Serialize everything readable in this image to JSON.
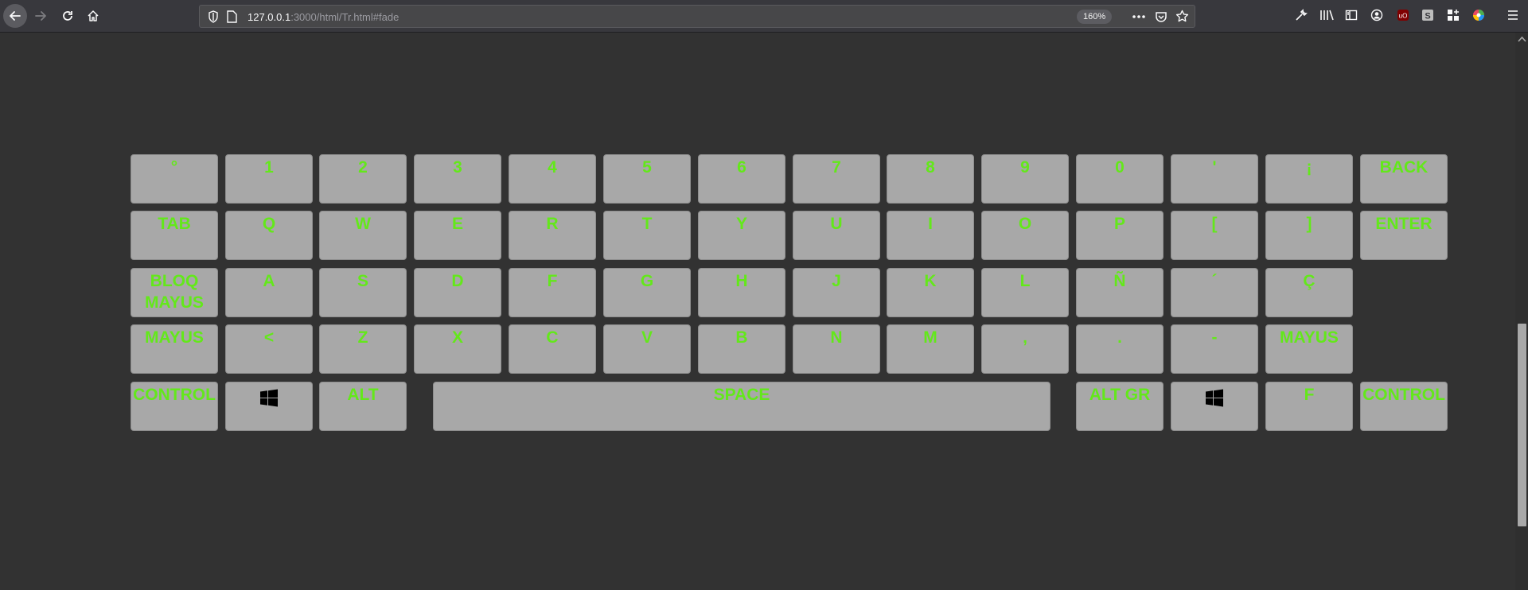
{
  "browser": {
    "url_host": "127.0.0.1",
    "url_rest": ":3000/html/Tr.html#fade",
    "zoom": "160%"
  },
  "keyboard": {
    "rows": [
      [
        {
          "label": "°"
        },
        {
          "label": "1"
        },
        {
          "label": "2"
        },
        {
          "label": "3"
        },
        {
          "label": "4"
        },
        {
          "label": "5"
        },
        {
          "label": "6"
        },
        {
          "label": "7"
        },
        {
          "label": "8"
        },
        {
          "label": "9"
        },
        {
          "label": "0"
        },
        {
          "label": "'"
        },
        {
          "label": "¡"
        },
        {
          "label": "BACK"
        }
      ],
      [
        {
          "label": "TAB"
        },
        {
          "label": "Q"
        },
        {
          "label": "W"
        },
        {
          "label": "E"
        },
        {
          "label": "R"
        },
        {
          "label": "T"
        },
        {
          "label": "Y"
        },
        {
          "label": "U"
        },
        {
          "label": "I"
        },
        {
          "label": "O"
        },
        {
          "label": "P"
        },
        {
          "label": "["
        },
        {
          "label": "]"
        },
        {
          "label": "ENTER"
        }
      ],
      [
        {
          "label": "BLOQ MAYUS"
        },
        {
          "label": "A"
        },
        {
          "label": "S"
        },
        {
          "label": "D"
        },
        {
          "label": "F"
        },
        {
          "label": "G"
        },
        {
          "label": "H"
        },
        {
          "label": "J"
        },
        {
          "label": "K"
        },
        {
          "label": "L"
        },
        {
          "label": "Ñ"
        },
        {
          "label": "´"
        },
        {
          "label": "Ç"
        }
      ],
      [
        {
          "label": "MAYUS"
        },
        {
          "label": "<"
        },
        {
          "label": "Z"
        },
        {
          "label": "X"
        },
        {
          "label": "C"
        },
        {
          "label": "V"
        },
        {
          "label": "B"
        },
        {
          "label": "N"
        },
        {
          "label": "M"
        },
        {
          "label": ","
        },
        {
          "label": "."
        },
        {
          "label": "-"
        },
        {
          "label": "MAYUS"
        }
      ],
      [
        {
          "label": "CONTROL"
        },
        {
          "label": "",
          "icon": "windows-icon"
        },
        {
          "label": "ALT"
        },
        {
          "label": "SPACE"
        },
        {
          "label": "ALT GR"
        },
        {
          "label": "",
          "icon": "windows-icon"
        },
        {
          "label": "F"
        },
        {
          "label": "CONTROL"
        }
      ]
    ],
    "key_color": "#a8a8a8",
    "text_color": "#63e81a",
    "background": "#323232"
  }
}
